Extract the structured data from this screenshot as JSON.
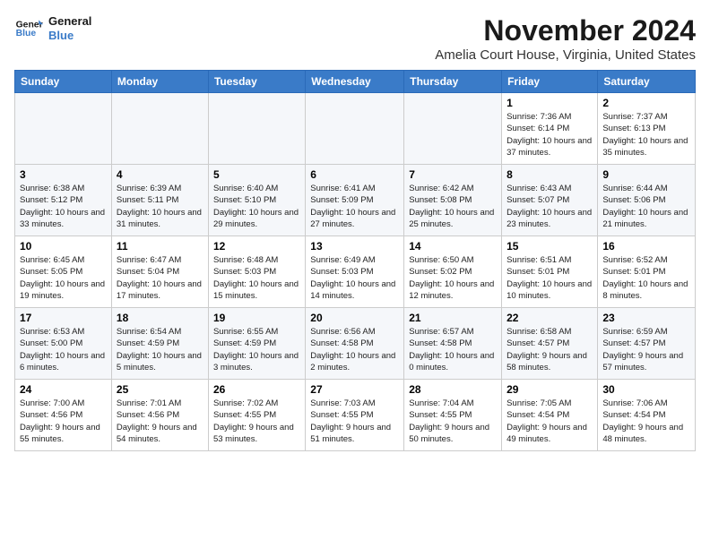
{
  "logo": {
    "line1": "General",
    "line2": "Blue"
  },
  "title": "November 2024",
  "location": "Amelia Court House, Virginia, United States",
  "weekdays": [
    "Sunday",
    "Monday",
    "Tuesday",
    "Wednesday",
    "Thursday",
    "Friday",
    "Saturday"
  ],
  "weeks": [
    [
      {
        "day": "",
        "sunrise": "",
        "sunset": "",
        "daylight": ""
      },
      {
        "day": "",
        "sunrise": "",
        "sunset": "",
        "daylight": ""
      },
      {
        "day": "",
        "sunrise": "",
        "sunset": "",
        "daylight": ""
      },
      {
        "day": "",
        "sunrise": "",
        "sunset": "",
        "daylight": ""
      },
      {
        "day": "",
        "sunrise": "",
        "sunset": "",
        "daylight": ""
      },
      {
        "day": "1",
        "sunrise": "Sunrise: 7:36 AM",
        "sunset": "Sunset: 6:14 PM",
        "daylight": "Daylight: 10 hours and 37 minutes."
      },
      {
        "day": "2",
        "sunrise": "Sunrise: 7:37 AM",
        "sunset": "Sunset: 6:13 PM",
        "daylight": "Daylight: 10 hours and 35 minutes."
      }
    ],
    [
      {
        "day": "3",
        "sunrise": "Sunrise: 6:38 AM",
        "sunset": "Sunset: 5:12 PM",
        "daylight": "Daylight: 10 hours and 33 minutes."
      },
      {
        "day": "4",
        "sunrise": "Sunrise: 6:39 AM",
        "sunset": "Sunset: 5:11 PM",
        "daylight": "Daylight: 10 hours and 31 minutes."
      },
      {
        "day": "5",
        "sunrise": "Sunrise: 6:40 AM",
        "sunset": "Sunset: 5:10 PM",
        "daylight": "Daylight: 10 hours and 29 minutes."
      },
      {
        "day": "6",
        "sunrise": "Sunrise: 6:41 AM",
        "sunset": "Sunset: 5:09 PM",
        "daylight": "Daylight: 10 hours and 27 minutes."
      },
      {
        "day": "7",
        "sunrise": "Sunrise: 6:42 AM",
        "sunset": "Sunset: 5:08 PM",
        "daylight": "Daylight: 10 hours and 25 minutes."
      },
      {
        "day": "8",
        "sunrise": "Sunrise: 6:43 AM",
        "sunset": "Sunset: 5:07 PM",
        "daylight": "Daylight: 10 hours and 23 minutes."
      },
      {
        "day": "9",
        "sunrise": "Sunrise: 6:44 AM",
        "sunset": "Sunset: 5:06 PM",
        "daylight": "Daylight: 10 hours and 21 minutes."
      }
    ],
    [
      {
        "day": "10",
        "sunrise": "Sunrise: 6:45 AM",
        "sunset": "Sunset: 5:05 PM",
        "daylight": "Daylight: 10 hours and 19 minutes."
      },
      {
        "day": "11",
        "sunrise": "Sunrise: 6:47 AM",
        "sunset": "Sunset: 5:04 PM",
        "daylight": "Daylight: 10 hours and 17 minutes."
      },
      {
        "day": "12",
        "sunrise": "Sunrise: 6:48 AM",
        "sunset": "Sunset: 5:03 PM",
        "daylight": "Daylight: 10 hours and 15 minutes."
      },
      {
        "day": "13",
        "sunrise": "Sunrise: 6:49 AM",
        "sunset": "Sunset: 5:03 PM",
        "daylight": "Daylight: 10 hours and 14 minutes."
      },
      {
        "day": "14",
        "sunrise": "Sunrise: 6:50 AM",
        "sunset": "Sunset: 5:02 PM",
        "daylight": "Daylight: 10 hours and 12 minutes."
      },
      {
        "day": "15",
        "sunrise": "Sunrise: 6:51 AM",
        "sunset": "Sunset: 5:01 PM",
        "daylight": "Daylight: 10 hours and 10 minutes."
      },
      {
        "day": "16",
        "sunrise": "Sunrise: 6:52 AM",
        "sunset": "Sunset: 5:01 PM",
        "daylight": "Daylight: 10 hours and 8 minutes."
      }
    ],
    [
      {
        "day": "17",
        "sunrise": "Sunrise: 6:53 AM",
        "sunset": "Sunset: 5:00 PM",
        "daylight": "Daylight: 10 hours and 6 minutes."
      },
      {
        "day": "18",
        "sunrise": "Sunrise: 6:54 AM",
        "sunset": "Sunset: 4:59 PM",
        "daylight": "Daylight: 10 hours and 5 minutes."
      },
      {
        "day": "19",
        "sunrise": "Sunrise: 6:55 AM",
        "sunset": "Sunset: 4:59 PM",
        "daylight": "Daylight: 10 hours and 3 minutes."
      },
      {
        "day": "20",
        "sunrise": "Sunrise: 6:56 AM",
        "sunset": "Sunset: 4:58 PM",
        "daylight": "Daylight: 10 hours and 2 minutes."
      },
      {
        "day": "21",
        "sunrise": "Sunrise: 6:57 AM",
        "sunset": "Sunset: 4:58 PM",
        "daylight": "Daylight: 10 hours and 0 minutes."
      },
      {
        "day": "22",
        "sunrise": "Sunrise: 6:58 AM",
        "sunset": "Sunset: 4:57 PM",
        "daylight": "Daylight: 9 hours and 58 minutes."
      },
      {
        "day": "23",
        "sunrise": "Sunrise: 6:59 AM",
        "sunset": "Sunset: 4:57 PM",
        "daylight": "Daylight: 9 hours and 57 minutes."
      }
    ],
    [
      {
        "day": "24",
        "sunrise": "Sunrise: 7:00 AM",
        "sunset": "Sunset: 4:56 PM",
        "daylight": "Daylight: 9 hours and 55 minutes."
      },
      {
        "day": "25",
        "sunrise": "Sunrise: 7:01 AM",
        "sunset": "Sunset: 4:56 PM",
        "daylight": "Daylight: 9 hours and 54 minutes."
      },
      {
        "day": "26",
        "sunrise": "Sunrise: 7:02 AM",
        "sunset": "Sunset: 4:55 PM",
        "daylight": "Daylight: 9 hours and 53 minutes."
      },
      {
        "day": "27",
        "sunrise": "Sunrise: 7:03 AM",
        "sunset": "Sunset: 4:55 PM",
        "daylight": "Daylight: 9 hours and 51 minutes."
      },
      {
        "day": "28",
        "sunrise": "Sunrise: 7:04 AM",
        "sunset": "Sunset: 4:55 PM",
        "daylight": "Daylight: 9 hours and 50 minutes."
      },
      {
        "day": "29",
        "sunrise": "Sunrise: 7:05 AM",
        "sunset": "Sunset: 4:54 PM",
        "daylight": "Daylight: 9 hours and 49 minutes."
      },
      {
        "day": "30",
        "sunrise": "Sunrise: 7:06 AM",
        "sunset": "Sunset: 4:54 PM",
        "daylight": "Daylight: 9 hours and 48 minutes."
      }
    ]
  ]
}
